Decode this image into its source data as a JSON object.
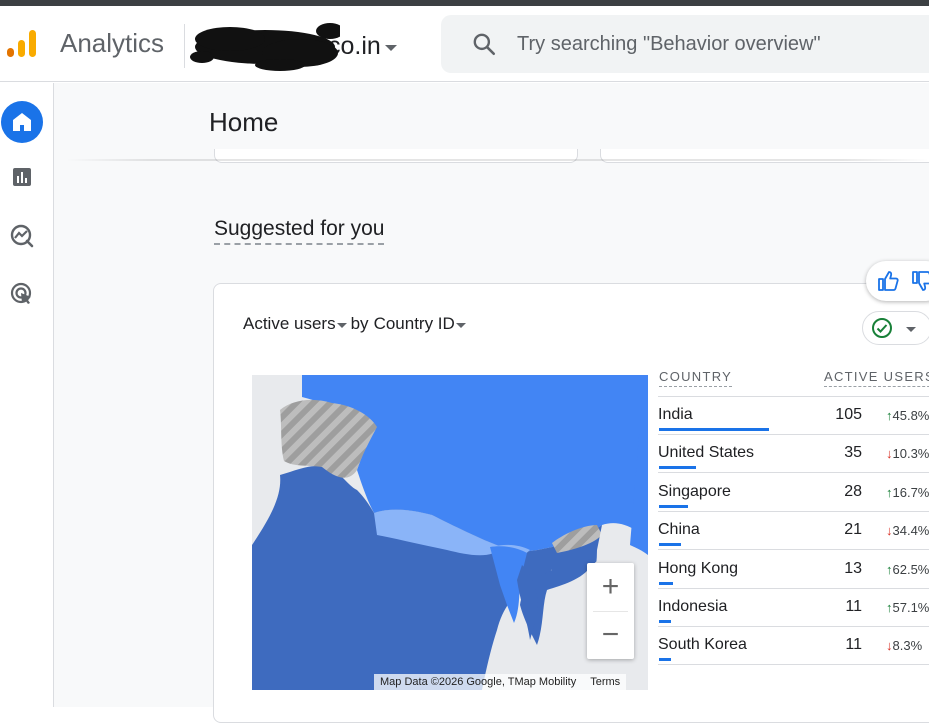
{
  "header": {
    "app_name": "Analytics",
    "account_name": "co.in",
    "search_placeholder": "Try searching \"Behavior overview\""
  },
  "sidebar": {
    "items": [
      {
        "icon": "home-icon",
        "active": true
      },
      {
        "icon": "reports-icon",
        "active": false
      },
      {
        "icon": "explore-icon",
        "active": false
      },
      {
        "icon": "advertising-icon",
        "active": false
      }
    ]
  },
  "page": {
    "title": "Home",
    "section_title": "Suggested for you"
  },
  "card": {
    "metric": "Active users",
    "by": "by",
    "dimension": "Country ID",
    "table": {
      "col_country": "COUNTRY",
      "col_users": "ACTIVE USERS",
      "rows": [
        {
          "country": "India",
          "users": "105",
          "dir": "up",
          "change": "45.8%",
          "share": 1.0
        },
        {
          "country": "United States",
          "users": "35",
          "dir": "down",
          "change": "10.3%",
          "share": 0.333
        },
        {
          "country": "Singapore",
          "users": "28",
          "dir": "up",
          "change": "16.7%",
          "share": 0.267
        },
        {
          "country": "China",
          "users": "21",
          "dir": "down",
          "change": "34.4%",
          "share": 0.2
        },
        {
          "country": "Hong Kong",
          "users": "13",
          "dir": "up",
          "change": "62.5%",
          "share": 0.124
        },
        {
          "country": "Indonesia",
          "users": "11",
          "dir": "up",
          "change": "57.1%",
          "share": 0.105
        },
        {
          "country": "South Korea",
          "users": "11",
          "dir": "down",
          "change": "8.3%",
          "share": 0.105
        }
      ]
    },
    "map": {
      "attribution": "Map Data ©2026 Google, TMap Mobility",
      "terms": "Terms",
      "zoom_in": "+",
      "zoom_out": "−"
    }
  },
  "colors": {
    "accent": "#1a73e8",
    "positive": "#188038",
    "negative": "#d93025"
  }
}
